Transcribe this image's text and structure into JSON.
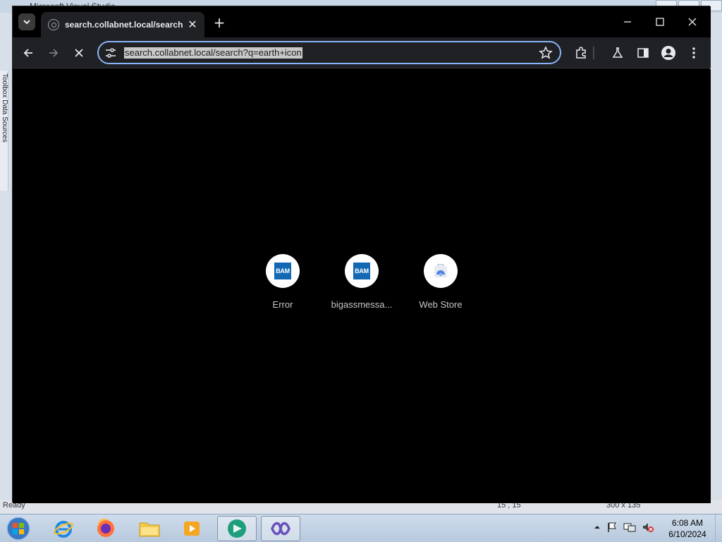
{
  "background_app": {
    "title": "Microsoft Visual Studio",
    "side_panel_text": "Toolbox  Data Sources",
    "status_left": "Ready",
    "status_mid": "15 , 15",
    "status_right": "300 x 135"
  },
  "browser": {
    "tab": {
      "title": "search.collabnet.local/search?q",
      "close_label": "✕"
    },
    "new_tab_label": "+",
    "window_controls": {
      "minimize": "—",
      "maximize": "☐",
      "close": "✕"
    },
    "toolbar": {
      "url": "search.collabnet.local/search?q=earth+icon"
    },
    "shortcuts": [
      {
        "label": "Error",
        "icon": "BAM"
      },
      {
        "label": "bigassmessa...",
        "icon": "BAM"
      },
      {
        "label": "Web Store",
        "icon": "web-store-icon"
      }
    ]
  },
  "taskbar": {
    "time": "6:08 AM",
    "date": "6/10/2024"
  },
  "colors": {
    "accent": "#8ab4f8",
    "tab_bg": "#202124",
    "bam_blue": "#1268b3"
  }
}
